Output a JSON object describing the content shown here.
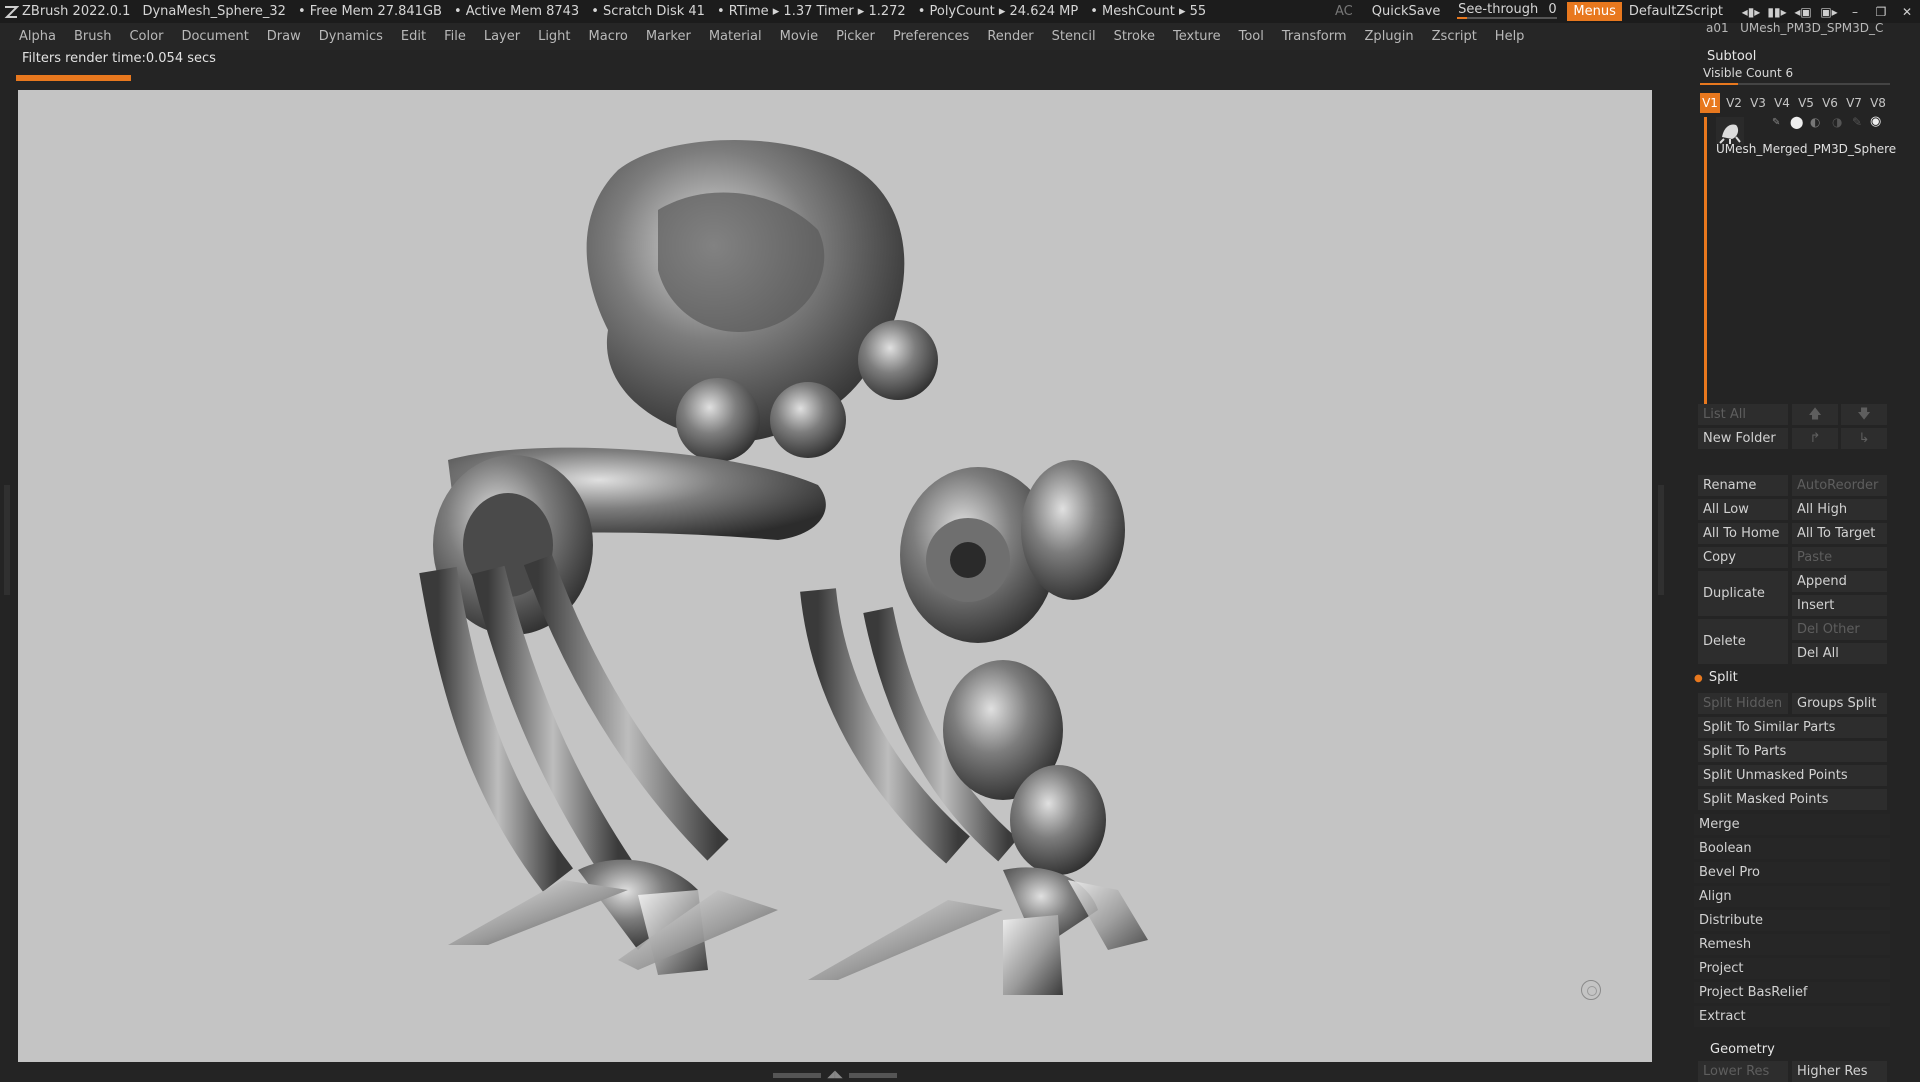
{
  "titlebar": {
    "app": "ZBrush 2022.0.1",
    "document": "DynaMesh_Sphere_32",
    "free_mem": "• Free Mem 27.841GB",
    "active_mem": "• Active Mem 8743",
    "scratch": "• Scratch Disk 41",
    "rtime": "• RTime ▸ 1.37 Timer ▸ 1.272",
    "polycount": "• PolyCount ▸ 24.624 MP",
    "meshcount": "• MeshCount ▸ 55",
    "ac": "AC",
    "quicksave": "QuickSave",
    "seethrough_label": "See-through",
    "seethrough_value": "0",
    "seethrough_level": 0.1,
    "menus": "Menus",
    "zscript": "DefaultZScript"
  },
  "menubar": [
    "Alpha",
    "Brush",
    "Color",
    "Document",
    "Draw",
    "Dynamics",
    "Edit",
    "File",
    "Layer",
    "Light",
    "Macro",
    "Marker",
    "Material",
    "Movie",
    "Picker",
    "Preferences",
    "Render",
    "Stencil",
    "Stroke",
    "Texture",
    "Tool",
    "Transform",
    "Zplugin",
    "Zscript",
    "Help"
  ],
  "status": {
    "text": "Filters render time:0.054 secs",
    "progress": 0.07
  },
  "panel": {
    "top_clip": "UMesh_PM3D_SPM3D_C",
    "top_clip_prefix": "a01",
    "subtool_title": "Subtool",
    "visible_count": "Visible Count 6",
    "visible_level": 0.2,
    "tabs": [
      "V1",
      "V2",
      "V3",
      "V4",
      "V5",
      "V6",
      "V7",
      "V8"
    ],
    "active_tab": 0,
    "subtool_name": "UMesh_Merged_PM3D_Sphere",
    "list_all": "List All",
    "new_folder": "New Folder",
    "rename": "Rename",
    "autoreorder": "AutoReorder",
    "all_low": "All Low",
    "all_high": "All High",
    "all_to_home": "All To Home",
    "all_to_target": "All To Target",
    "copy": "Copy",
    "paste": "Paste",
    "duplicate": "Duplicate",
    "append": "Append",
    "insert": "Insert",
    "delete": "Delete",
    "del_other": "Del Other",
    "del_all": "Del All",
    "split_title": "Split",
    "split_hidden": "Split Hidden",
    "groups_split": "Groups Split",
    "split_similar": "Split To Similar Parts",
    "split_parts": "Split To Parts",
    "split_unmasked": "Split Unmasked Points",
    "split_masked": "Split Masked Points",
    "sections": [
      "Merge",
      "Boolean",
      "Bevel Pro",
      "Align",
      "Distribute",
      "Remesh",
      "Project",
      "Project BasRelief",
      "Extract"
    ],
    "geometry_title": "Geometry",
    "lower_res": "Lower Res",
    "higher_res": "Higher Res"
  }
}
